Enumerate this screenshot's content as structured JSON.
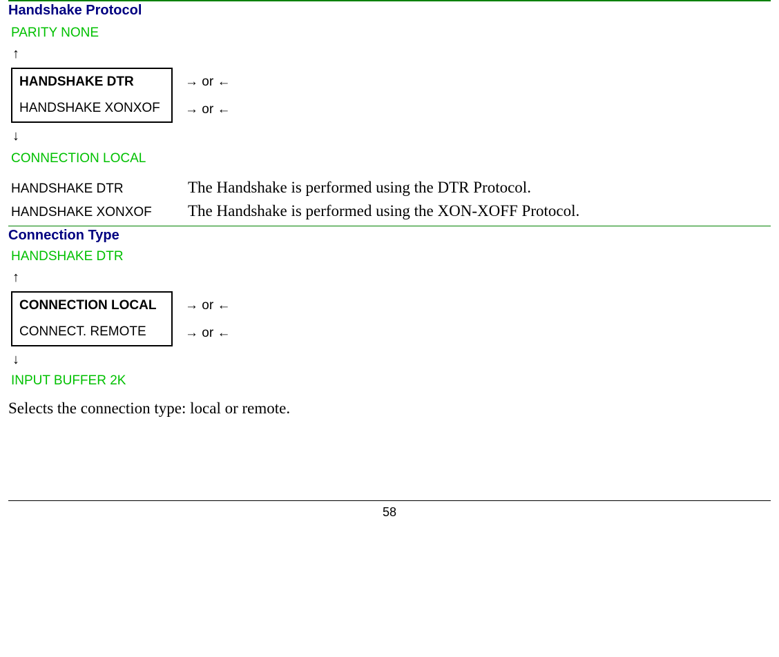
{
  "section1": {
    "title": "Handshake Protocol",
    "above": "PARITY NONE",
    "arrow_up": "↑",
    "menu": {
      "row1": "HANDSHAKE DTR",
      "row2": "HANDSHAKE XONXOF",
      "arr1": "→ or ←",
      "arr2": "→ or ←"
    },
    "arrow_down": "↓",
    "below": "CONNECTION LOCAL",
    "desc": [
      {
        "label": "HANDSHAKE DTR",
        "text": "The Handshake is performed using the DTR Protocol."
      },
      {
        "label": "HANDSHAKE  XONXOF",
        "text": "The Handshake is performed using the XON-XOFF Protocol."
      }
    ]
  },
  "section2": {
    "title": "Connection Type",
    "above": "HANDSHAKE DTR",
    "arrow_up": "↑",
    "menu": {
      "row1": "CONNECTION LOCAL",
      "row2": "CONNECT. REMOTE",
      "arr1": "→ or ←",
      "arr2": "→ or ←"
    },
    "arrow_down": "↓",
    "below": "INPUT BUFFER 2K",
    "body": "Selects the connection type: local or remote."
  },
  "page_number": "58"
}
